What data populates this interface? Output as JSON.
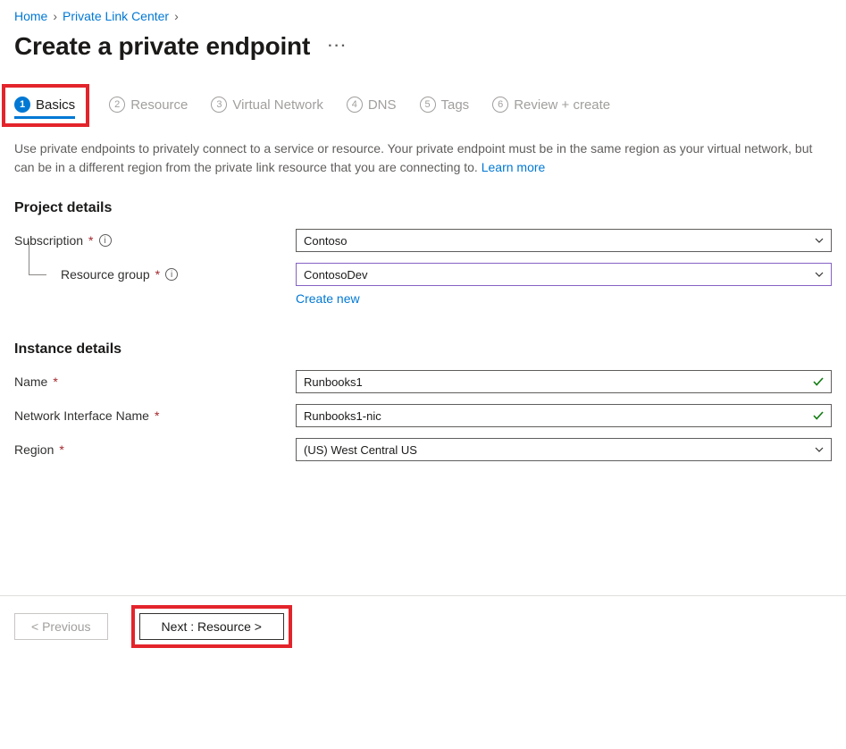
{
  "breadcrumb": {
    "items": [
      {
        "label": "Home"
      },
      {
        "label": "Private Link Center"
      }
    ]
  },
  "title": "Create a private endpoint",
  "tabs": [
    {
      "num": "1",
      "label": "Basics",
      "active": true
    },
    {
      "num": "2",
      "label": "Resource"
    },
    {
      "num": "3",
      "label": "Virtual Network"
    },
    {
      "num": "4",
      "label": "DNS"
    },
    {
      "num": "5",
      "label": "Tags"
    },
    {
      "num": "6",
      "label": "Review + create"
    }
  ],
  "description": {
    "text": "Use private endpoints to privately connect to a service or resource. Your private endpoint must be in the same region as your virtual network, but can be in a different region from the private link resource that you are connecting to.  ",
    "learnMore": "Learn more"
  },
  "sections": {
    "project": {
      "title": "Project details",
      "subscription": {
        "label": "Subscription",
        "value": "Contoso"
      },
      "resourceGroup": {
        "label": "Resource group",
        "value": "ContosoDev",
        "createNew": "Create new"
      }
    },
    "instance": {
      "title": "Instance details",
      "name": {
        "label": "Name",
        "value": "Runbooks1"
      },
      "nic": {
        "label": "Network Interface Name",
        "value": "Runbooks1-nic"
      },
      "region": {
        "label": "Region",
        "value": "(US) West Central US"
      }
    }
  },
  "footer": {
    "previous": "< Previous",
    "next": "Next : Resource >"
  }
}
